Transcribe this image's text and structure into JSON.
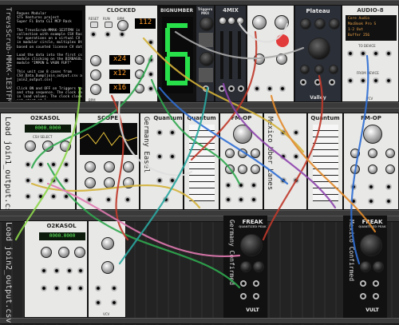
{
  "rack_modules": {
    "notes": {
      "label_vertical": "TrevsScrub-MMAK-1E3TFMV",
      "text": "Rogues Modular\nSTS Ventures project\nSuper Fi Data CLI MCP Rack\n\nThe TrevsScrub-MMAK-1E3TFMV is a data\ncollection with example CSV Rack\nfor operations on a virtual CV\nin modular circle, multiplex 8th\nbased on counted license CV data.\n\nLoad the data into the first csv\nmodule clicking on the BIRBAGOL\nmodule \"IMPON & VAUN FUFT\"\n\nThis unit can 8 cases from\nCSV_Data_Dump[join_output.csv and\njoin2_output.csv]\n\nClick ON and OFF on Triggers to start\nand stop sequence. The clock range is\nin load values. The clock clocks for\nnot start at 1.\n\nWatch the patch cables to see/Read\nnext locations."
    },
    "clocked": {
      "title": "CLOCKED",
      "bpm": "112",
      "ratio_labels": [
        "RESET",
        "RUN",
        "BPM",
        "RESET",
        "RUN",
        "BPM"
      ],
      "displays": [
        "x24",
        "x12",
        "x16"
      ],
      "bottom_labels": [
        "BPM",
        "CLK1",
        "CLK2",
        "CLK3"
      ]
    },
    "bignumber": {
      "title": "BIGNUMBER",
      "value": "6"
    },
    "triggers": {
      "title": "Triggers MKII"
    },
    "fourmix": {
      "title": "4MIX"
    },
    "plateau": {
      "title": "Plateau",
      "footer": "Valley"
    },
    "audio": {
      "title": "AUDIO-8",
      "device_lines": [
        "Core Audio",
        "MacBook Pro S",
        "1-2 Out",
        "Buffer 256"
      ],
      "to_device": "TO DEVICE",
      "from_device": "FROM DEVICE",
      "footer": "VCV"
    },
    "scope": {
      "title": "SCOPE"
    },
    "o2kasol_top": {
      "title": "O2KASOL",
      "label_vertical": "Load join1_output.csv",
      "sub_label": "CSV SELECT",
      "lcd": "0000.0000",
      "footer": "BETA"
    },
    "o2kasol_bottom": {
      "title": "O2KASOL",
      "label_vertical": "Load join2_output.csv",
      "lcd": "0000.0000",
      "footer": "VCV"
    },
    "quantum_left": {
      "title": "Quantum",
      "side_label": "Germany Easel"
    },
    "fmop_left": {
      "title": "FM-OP"
    },
    "quantum_right": {
      "title": "Quantum",
      "side_label": "Mexico Uber Lanes"
    },
    "fmop_right": {
      "title": "FM-OP"
    },
    "freak_left": {
      "title": "FREAK",
      "subtitle": "QUANTIZED PEAK",
      "side_label": "Germany Confirmed",
      "brand": "VULT"
    },
    "freak_right": {
      "title": "FREAK",
      "subtitle": "QUANTIZED PEAK",
      "side_label": "Mexico Confirmed",
      "brand": "VULT"
    },
    "vcv_mid": {
      "footer": "VCV"
    }
  },
  "colors": {
    "cable_green": "#2fa84f",
    "cable_yellow": "#d4b23a",
    "cable_red": "#c0392b",
    "cable_blue": "#2f6fd4",
    "cable_purple": "#8e44ad",
    "cable_pink": "#e07ab0",
    "cable_orange": "#e28a2b",
    "cable_white": "#e0e0e0",
    "bignumber_green": "#27e04a"
  }
}
